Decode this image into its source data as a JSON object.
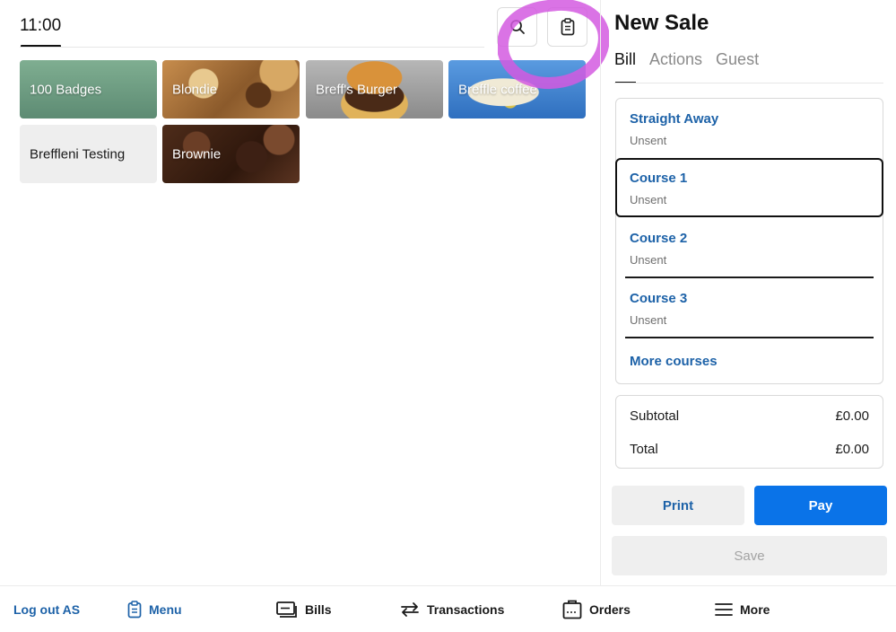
{
  "header": {
    "time": "11:00"
  },
  "toolbar": {
    "search_icon": "search-icon",
    "clipboard_icon": "clipboard-icon"
  },
  "tiles": [
    {
      "label": "100 Badges"
    },
    {
      "label": "Blondie"
    },
    {
      "label": "Breff's Burger"
    },
    {
      "label": "Breffle coffee"
    },
    {
      "label": "Breffleni Testing"
    },
    {
      "label": "Brownie"
    }
  ],
  "bill": {
    "title": "New Sale",
    "tabs": [
      "Bill",
      "Actions",
      "Guest"
    ],
    "courses": [
      {
        "name": "Straight Away",
        "status": "Unsent"
      },
      {
        "name": "Course 1",
        "status": "Unsent"
      },
      {
        "name": "Course 2",
        "status": "Unsent"
      },
      {
        "name": "Course 3",
        "status": "Unsent"
      }
    ],
    "more_courses": "More courses",
    "subtotal_label": "Subtotal",
    "subtotal_value": "£0.00",
    "total_label": "Total",
    "total_value": "£0.00",
    "print_label": "Print",
    "pay_label": "Pay",
    "save_label": "Save"
  },
  "nav": {
    "logout": "Log out AS",
    "menu": "Menu",
    "bills": "Bills",
    "transactions": "Transactions",
    "orders": "Orders",
    "more": "More"
  },
  "colors": {
    "accent_blue": "#1d62a8",
    "pay_blue": "#0a73e8",
    "highlight_magenta": "#d35be0"
  }
}
